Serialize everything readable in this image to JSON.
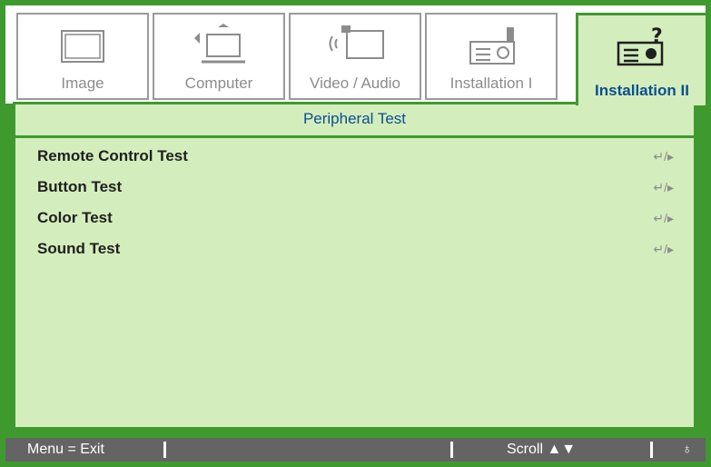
{
  "tabs": [
    {
      "label": "Image",
      "icon": "monitor-icon",
      "active": false
    },
    {
      "label": "Computer",
      "icon": "computer-icon",
      "active": false
    },
    {
      "label": "Video / Audio",
      "icon": "video-audio-icon",
      "active": false
    },
    {
      "label": "Installation I",
      "icon": "projector-icon",
      "active": false
    },
    {
      "label": "Installation II",
      "icon": "projector-help-icon",
      "active": true
    }
  ],
  "panel": {
    "title": "Peripheral Test",
    "items": [
      {
        "label": "Remote Control Test",
        "action": "↵/▸"
      },
      {
        "label": "Button Test",
        "action": "↵/▸"
      },
      {
        "label": "Color Test",
        "action": "↵/▸"
      },
      {
        "label": "Sound Test",
        "action": "↵/▸"
      }
    ]
  },
  "status_bar": {
    "menu_exit": "Menu = Exit",
    "scroll": "Scroll ▲▼",
    "bulb": "♁"
  },
  "colors": {
    "frame_green": "#3e9a2f",
    "panel_green": "#d4edbd",
    "title_blue": "#0b4f8f",
    "status_gray": "#646464"
  }
}
